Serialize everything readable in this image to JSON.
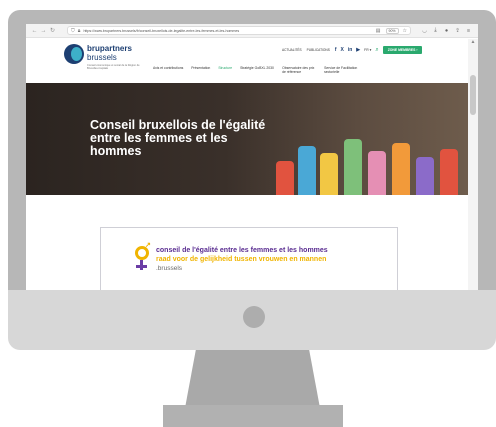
{
  "browser": {
    "url": "https://www.brupartners.brussels/fr/conseil-bruxellois-de-legalite-entre-les-femmes-et-les-hommes",
    "zoom": "90%"
  },
  "site": {
    "logo_line1": "brupartners",
    "logo_line2": "brussels",
    "logo_tagline": "Conseil économique et social de la Région de Bruxelles-Capitale",
    "main_nav": [
      "Avis et contributions",
      "Présentation",
      "Structure",
      "Stratégie GoBXL 2030",
      "Observatoire des prix de référence",
      "Service de Facilitation sectorielle"
    ],
    "util_nav": [
      "ACTUALITÉS",
      "PUBLICATIONS"
    ],
    "social": [
      "f",
      "X",
      "in",
      "▶"
    ],
    "language": "FR ▾",
    "zone_button": "ZONE MEMBRES ›"
  },
  "hero": {
    "title": "Conseil bruxellois de l'égalité entre les femmes et les hommes"
  },
  "card": {
    "line1": "conseil de l'égalité entre les femmes et les hommes",
    "line2": "raad voor de gelijkheid tussen vrouwen en mannen",
    "line3": ".brussels"
  },
  "colors": {
    "brand_blue": "#1d3f72",
    "brand_green": "#2aa96e",
    "purple": "#5a2d91",
    "yellow": "#f0b400"
  }
}
